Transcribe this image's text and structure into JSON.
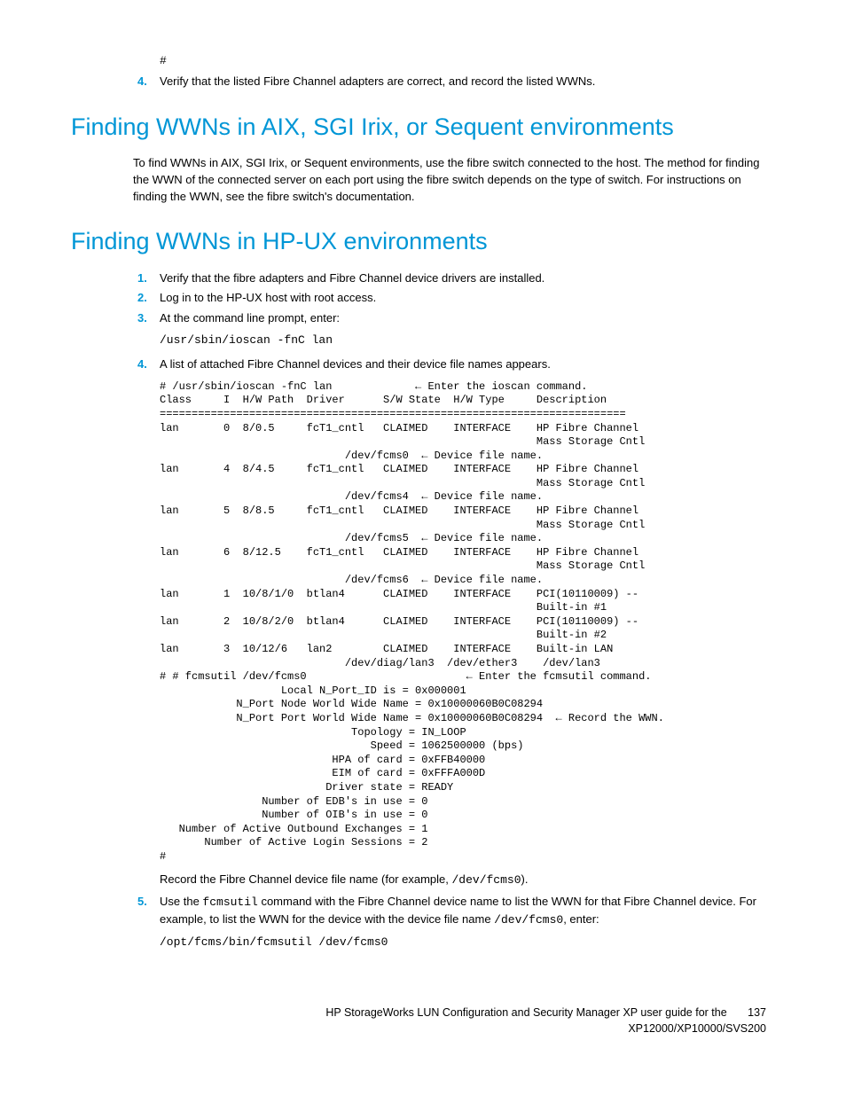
{
  "intro": {
    "hash": "#",
    "step4_num": "4.",
    "step4_text": "Verify that the listed Fibre Channel adapters are correct, and record the listed WWNs."
  },
  "section_aix": {
    "heading": "Finding WWNs in AIX, SGI Irix, or Sequent environments",
    "para": "To find WWNs in AIX, SGI Irix, or Sequent environments, use the fibre switch connected to the host. The method for finding the WWN of the connected server on each port using the fibre switch depends on the type of switch. For instructions on finding the WWN, see the fibre switch's documentation."
  },
  "section_hpux": {
    "heading": "Finding WWNs in HP-UX environments",
    "steps": [
      {
        "num": "1.",
        "text": "Verify that the fibre adapters and Fibre Channel device drivers are installed."
      },
      {
        "num": "2.",
        "text": "Log in to the HP-UX host with root access."
      },
      {
        "num": "3.",
        "text": "At the command line prompt, enter:"
      }
    ],
    "cmd3": "/usr/sbin/ioscan -fnC lan",
    "step4_num": "4.",
    "step4_text": "A list of attached Fibre Channel devices and their device file names appears.",
    "terminal": "# /usr/sbin/ioscan -fnC lan             ← Enter the ioscan command.\nClass     I  H/W Path  Driver      S/W State  H/W Type     Description\n=========================================================================\nlan       0  8/0.5     fcT1_cntl   CLAIMED    INTERFACE    HP Fibre Channel\n                                                           Mass Storage Cntl\n                             /dev/fcms0  ← Device file name.\nlan       4  8/4.5     fcT1_cntl   CLAIMED    INTERFACE    HP Fibre Channel\n                                                           Mass Storage Cntl\n                             /dev/fcms4  ← Device file name.\nlan       5  8/8.5     fcT1_cntl   CLAIMED    INTERFACE    HP Fibre Channel\n                                                           Mass Storage Cntl\n                             /dev/fcms5  ← Device file name.\nlan       6  8/12.5    fcT1_cntl   CLAIMED    INTERFACE    HP Fibre Channel\n                                                           Mass Storage Cntl\n                             /dev/fcms6  ← Device file name.\nlan       1  10/8/1/0  btlan4      CLAIMED    INTERFACE    PCI(10110009) --\n                                                           Built-in #1\nlan       2  10/8/2/0  btlan4      CLAIMED    INTERFACE    PCI(10110009) --\n                                                           Built-in #2\nlan       3  10/12/6   lan2        CLAIMED    INTERFACE    Built-in LAN\n                             /dev/diag/lan3  /dev/ether3    /dev/lan3\n# # fcmsutil /dev/fcms0                         ← Enter the fcmsutil command.\n                   Local N_Port_ID is = 0x000001\n            N_Port Node World Wide Name = 0x10000060B0C08294\n            N_Port Port World Wide Name = 0x10000060B0C08294  ← Record the WWN.\n                              Topology = IN_LOOP\n                                 Speed = 1062500000 (bps)\n                           HPA of card = 0xFFB40000\n                           EIM of card = 0xFFFA000D\n                          Driver state = READY\n                Number of EDB's in use = 0\n                Number of OIB's in use = 0\n   Number of Active Outbound Exchanges = 1\n       Number of Active Login Sessions = 2\n#",
    "post_terminal_pre": "Record the Fibre Channel device file name (for example, ",
    "post_terminal_code": "/dev/fcms0",
    "post_terminal_post": ").",
    "step5_num": "5.",
    "step5_a": "Use the ",
    "step5_code1": "fcmsutil",
    "step5_b": " command with the Fibre Channel device name to list the WWN for that Fibre Channel device. For example, to list the WWN for the device with the device file name ",
    "step5_code2": "/dev/fcms0",
    "step5_c": ", enter:",
    "cmd5": "/opt/fcms/bin/fcmsutil /dev/fcms0"
  },
  "footer": {
    "line1": "HP StorageWorks LUN Configuration and Security Manager XP user guide for the",
    "line2": "XP12000/XP10000/SVS200",
    "page": "137"
  }
}
